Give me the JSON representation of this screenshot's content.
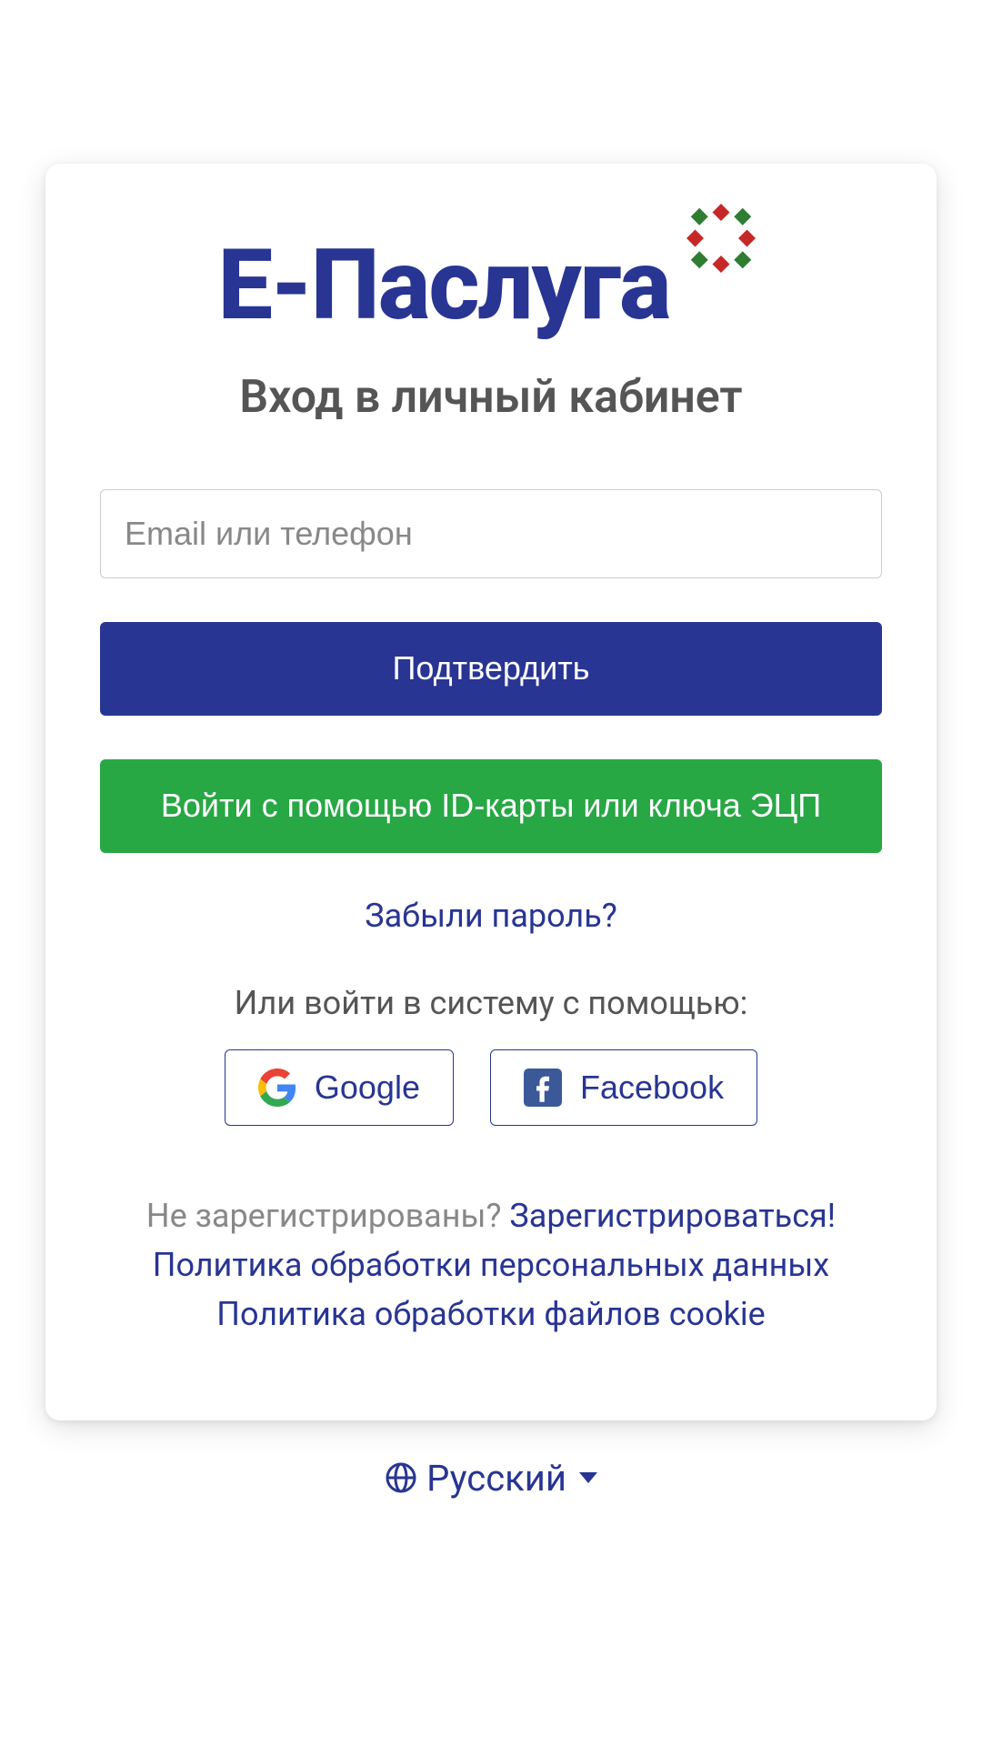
{
  "logo": {
    "text": "Е-Паслуга"
  },
  "heading": "Вход в личный кабинет",
  "login_input": {
    "placeholder": "Email или телефон"
  },
  "buttons": {
    "submit": "Подтвердить",
    "id_card": "Войти с помощью ID-карты или ключа ЭЦП"
  },
  "links": {
    "forgot": "Забыли пароль?",
    "register_prompt": "Не зарегистрированы? ",
    "register": "Зарегистрироваться!",
    "privacy": "Политика обработки персональных данных",
    "cookies": "Политика обработки файлов cookie"
  },
  "social": {
    "label": "Или войти в систему с помощью:",
    "google": "Google",
    "facebook": "Facebook"
  },
  "language": {
    "current": "Русский"
  }
}
